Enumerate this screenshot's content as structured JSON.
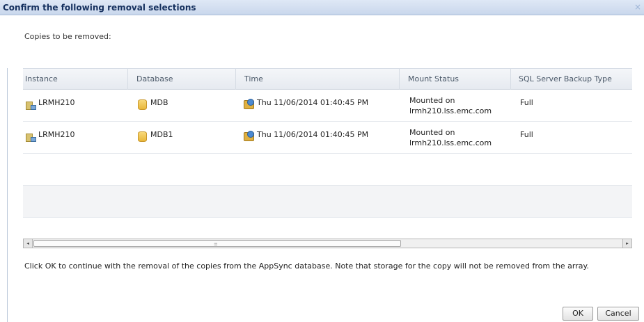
{
  "dialog": {
    "title": "Confirm the following removal selections",
    "close_icon": "close-icon",
    "subheading": "Copies to be removed:",
    "note": "Click OK to continue with the removal of the copies from the AppSync database.  Note that storage for the copy will not be removed from the array.",
    "ok_label": "OK",
    "cancel_label": "Cancel"
  },
  "table": {
    "columns": [
      "Instance",
      "Database",
      "Time",
      "Mount Status",
      "SQL Server Backup Type"
    ],
    "rows": [
      {
        "instance": "LRMH210",
        "database": "MDB",
        "time": "Thu 11/06/2014 01:40:45 PM",
        "mount_line1": "Mounted on",
        "mount_line2": "lrmh210.lss.emc.com",
        "backup_type": "Full"
      },
      {
        "instance": "LRMH210",
        "database": "MDB1",
        "time": "Thu 11/06/2014 01:40:45 PM",
        "mount_line1": "Mounted on",
        "mount_line2": "lrmh210.lss.emc.com",
        "backup_type": "Full"
      }
    ],
    "icons": {
      "instance": "server-instance-icon",
      "database": "database-icon",
      "time": "copy-time-icon"
    }
  },
  "scrollbar": {
    "left_arrow": "◂",
    "right_arrow": "▸",
    "grip": "≡"
  }
}
